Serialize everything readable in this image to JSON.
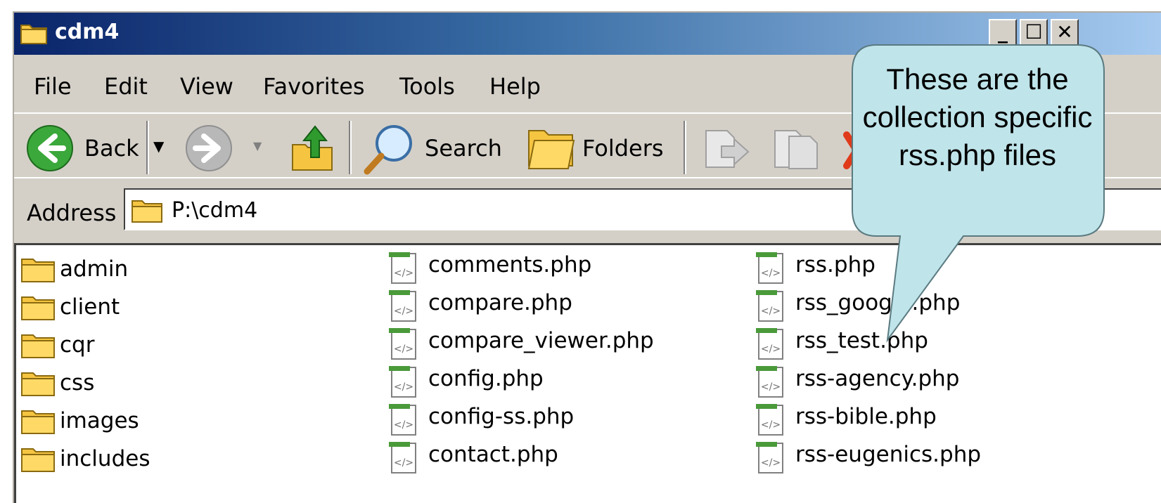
{
  "window": {
    "title": "cdm4"
  },
  "menu": [
    "File",
    "Edit",
    "View",
    "Favorites",
    "Tools",
    "Help"
  ],
  "toolbar": {
    "back": "Back",
    "search": "Search",
    "folders": "Folders"
  },
  "address": {
    "label": "Address",
    "value": "P:\\cdm4"
  },
  "files": {
    "col1": [
      "admin",
      "client",
      "cqr",
      "css",
      "images",
      "includes"
    ],
    "col2": [
      "comments.php",
      "compare.php",
      "compare_viewer.php",
      "config.php",
      "config-ss.php",
      "contact.php"
    ],
    "col3": [
      "rss.php",
      "rss_google.php",
      "rss_test.php",
      "rss-agency.php",
      "rss-bible.php",
      "rss-eugenics.php"
    ]
  },
  "callout": {
    "text": "These are the collection specific rss.php files"
  },
  "icons": {
    "folder": "folder-icon",
    "php": "php-file-icon"
  },
  "colors": {
    "titlebar_start": "#0a246a",
    "titlebar_end": "#a6caf0",
    "callout_fill": "#bfe4ea",
    "chrome": "#d4d0c8"
  }
}
